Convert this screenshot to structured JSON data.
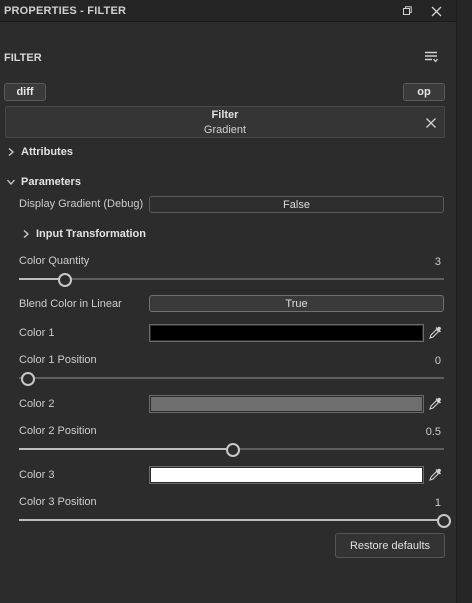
{
  "window": {
    "title": "PROPERTIES - FILTER",
    "restore_icon": "restore-window-icon",
    "close_icon": "close-icon"
  },
  "header": {
    "section": "FILTER",
    "menu_icon": "list-menu-icon"
  },
  "toolbar": {
    "diff_label": "diff",
    "op_label": "op"
  },
  "filter": {
    "name": "Filter",
    "type": "Gradient"
  },
  "groups": {
    "attributes": "Attributes",
    "parameters": "Parameters",
    "input_transformation": "Input Transformation"
  },
  "params": {
    "display_gradient": {
      "label": "Display Gradient (Debug)",
      "value": "False"
    },
    "color_quantity": {
      "label": "Color Quantity",
      "value": "3",
      "min": 1,
      "max": 20,
      "level": 3
    },
    "blend_linear": {
      "label": "Blend Color in Linear",
      "value": "True"
    },
    "color1": {
      "label": "Color 1",
      "color": "#000000"
    },
    "color1_pos": {
      "label": "Color 1 Position",
      "value": "0",
      "level": 0
    },
    "color2": {
      "label": "Color 2",
      "color": "#6e6e6e"
    },
    "color2_pos": {
      "label": "Color 2 Position",
      "value": "0.5",
      "level": 0.5
    },
    "color3": {
      "label": "Color 3",
      "color": "#ffffff"
    },
    "color3_pos": {
      "label": "Color 3 Position",
      "value": "1",
      "level": 1
    }
  },
  "footer": {
    "restore_label": "Restore defaults"
  },
  "colors": {
    "panel_bg": "#2c2c2c",
    "titlebar_bg": "#252525",
    "text": "#d8d8d8"
  }
}
